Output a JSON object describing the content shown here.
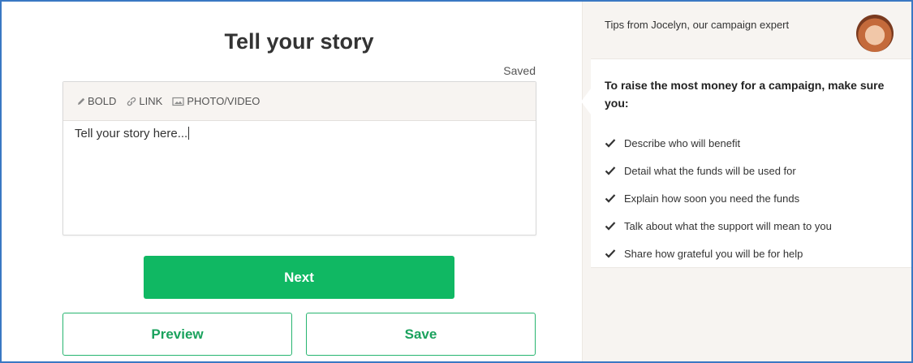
{
  "main": {
    "title": "Tell your story",
    "saved_status": "Saved",
    "toolbar": {
      "bold_label": "BOLD",
      "link_label": "LINK",
      "media_label": "PHOTO/VIDEO"
    },
    "story_text": "Tell your story here...",
    "next_label": "Next",
    "preview_label": "Preview",
    "save_label": "Save"
  },
  "tips": {
    "header": "Tips from Jocelyn, our campaign expert",
    "card_title": "To raise the most money for a campaign, make sure you:",
    "items": [
      "Describe who will benefit",
      "Detail what the funds will be used for",
      "Explain how soon you need the funds",
      "Talk about what the support will mean to you",
      "Share how grateful you will be for help"
    ]
  },
  "icons": {
    "bold": "pencil-icon",
    "link": "link-icon",
    "media": "image-icon",
    "check": "checkmark-icon",
    "avatar": "avatar"
  },
  "colors": {
    "primary_green": "#10b863",
    "outline_green": "#1aa25d",
    "frame_border": "#3a78c3",
    "panel_bg": "#f7f4f1"
  }
}
